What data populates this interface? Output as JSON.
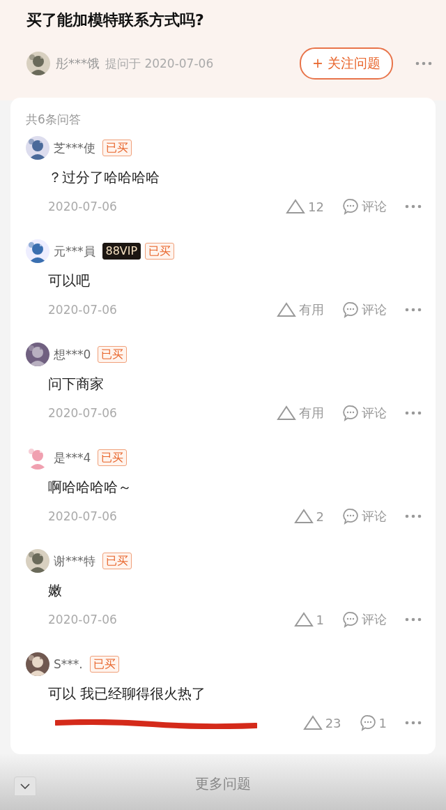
{
  "question": {
    "title": "买了能加模特联系方式吗?",
    "asker": "彤***饿",
    "asked": "提问于 2020-07-06",
    "follow_button": "+ 关注问题"
  },
  "answers_count": "共6条问答",
  "answers": [
    {
      "user": "芝***使",
      "badges": [
        {
          "kind": "bought",
          "label": "已买"
        }
      ],
      "text": "？过分了哈哈哈哈",
      "date": "2020-07-06",
      "like": "12",
      "comment": "评论",
      "date_scribbled": false
    },
    {
      "user": "元***員",
      "badges": [
        {
          "kind": "vip",
          "label": "88VIP"
        },
        {
          "kind": "bought",
          "label": "已买"
        }
      ],
      "text": "可以吧",
      "date": "2020-07-06",
      "like": "有用",
      "comment": "评论",
      "date_scribbled": false
    },
    {
      "user": "想***0",
      "badges": [
        {
          "kind": "bought",
          "label": "已买"
        }
      ],
      "text": "问下商家",
      "date": "2020-07-06",
      "like": "有用",
      "comment": "评论",
      "date_scribbled": false
    },
    {
      "user": "是***4",
      "badges": [
        {
          "kind": "bought",
          "label": "已买"
        }
      ],
      "text": "啊哈哈哈哈～",
      "date": "2020-07-06",
      "like": "2",
      "comment": "评论",
      "date_scribbled": false
    },
    {
      "user": "谢***特",
      "badges": [
        {
          "kind": "bought",
          "label": "已买"
        }
      ],
      "text": "嫩",
      "date": "2020-07-06",
      "like": "1",
      "comment": "评论",
      "date_scribbled": false
    },
    {
      "user": "S***.",
      "badges": [
        {
          "kind": "bought",
          "label": "已买"
        }
      ],
      "text": "可以 我已经聊得很火热了",
      "like": "23",
      "comment": "1",
      "date_scribbled": true
    }
  ],
  "more_link": "更多问题"
}
